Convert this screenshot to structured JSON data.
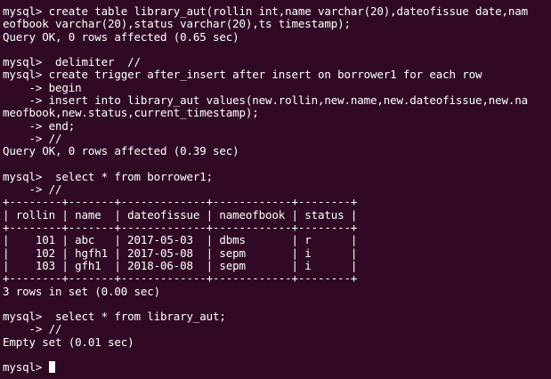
{
  "colors": {
    "background": "#300a24",
    "foreground": "#ffffff"
  },
  "terminal": {
    "lines": [
      "mysql> create table library_aut(rollin int,name varchar(20),dateofissue date,nam",
      "eofbook varchar(20),status varchar(20),ts timestamp);",
      "Query OK, 0 rows affected (0.65 sec)",
      "",
      "mysql>  delimiter  //",
      "mysql> create trigger after_insert after insert on borrower1 for each row",
      "    -> begin",
      "    -> insert into library_aut values(new.rollin,new.name,new.dateofissue,new.na",
      "meofbook,new.status,current_timestamp);",
      "    -> end;",
      "    -> //",
      "Query OK, 0 rows affected (0.39 sec)",
      "",
      "mysql>  select * from borrower1;",
      "    -> //",
      "+--------+-------+-------------+------------+--------+",
      "| rollin | name  | dateofissue | nameofbook | status |",
      "+--------+-------+-------------+------------+--------+",
      "|    101 | abc   | 2017-05-03  | dbms       | r      |",
      "|    102 | hgfh1 | 2017-05-08  | sepm       | i      |",
      "|    103 | gfh1  | 2018-06-08  | sepm       | i      |",
      "+--------+-------+-------------+------------+--------+",
      "3 rows in set (0.00 sec)",
      "",
      "mysql>  select * from library_aut;",
      "    -> //",
      "Empty set (0.01 sec)",
      "",
      "mysql> "
    ]
  }
}
